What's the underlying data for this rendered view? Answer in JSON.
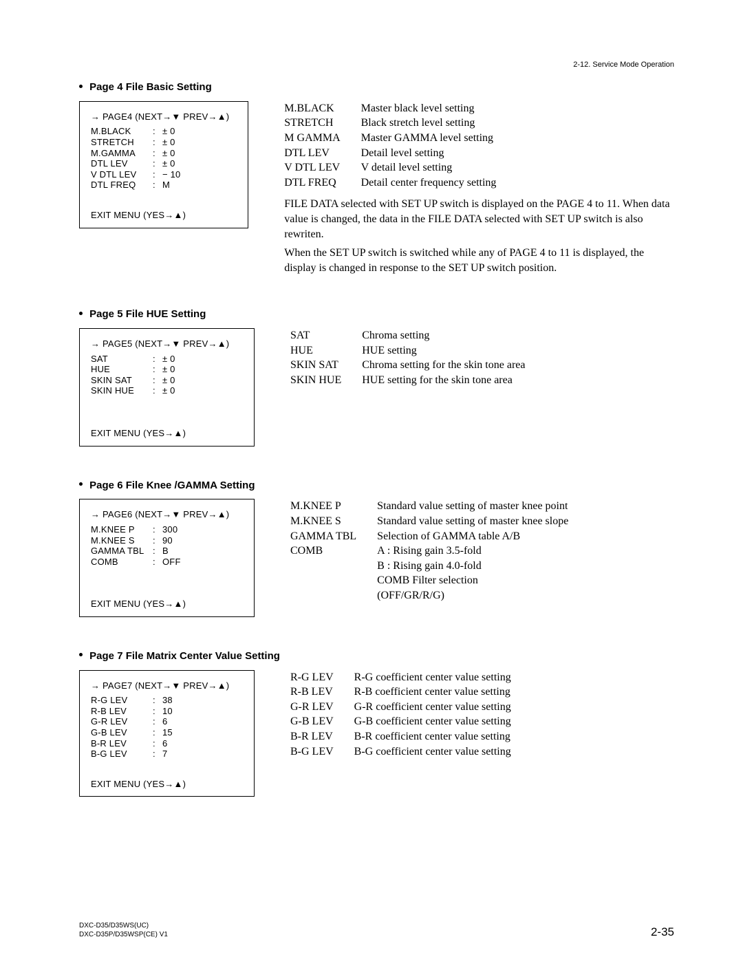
{
  "top_right": "2-12. Service Mode Operation",
  "sections": [
    {
      "title": "Page 4 File Basic Setting",
      "menu": {
        "header_prefix": "→ PAGE4  (NEXT→",
        "header_mid": "▼",
        "header_mid2": " PREV→",
        "header_suffix": "▲)",
        "rows": [
          {
            "lbl": "M.BLACK",
            "val": "± 0"
          },
          {
            "lbl": "STRETCH",
            "val": "± 0"
          },
          {
            "lbl": "M.GAMMA",
            "val": "± 0"
          },
          {
            "lbl": "DTL LEV",
            "val": "± 0"
          },
          {
            "lbl": "V DTL LEV",
            "val": "− 10"
          },
          {
            "lbl": "DTL FREQ",
            "val": "   M"
          }
        ],
        "exit": "EXIT MENU   (YES→▲)"
      },
      "desc_rows": [
        {
          "label": "M.BLACK",
          "text": "Master black level setting"
        },
        {
          "label": "STRETCH",
          "text": "Black stretch level setting"
        },
        {
          "label": "M GAMMA",
          "text": "Master GAMMA level setting"
        },
        {
          "label": "DTL LEV",
          "text": "Detail level setting"
        },
        {
          "label": "V DTL LEV",
          "text": "V detail level setting"
        },
        {
          "label": "DTL FREQ",
          "text": "Detail center frequency setting"
        }
      ],
      "para1": "FILE DATA selected with SET UP switch is displayed on the PAGE 4 to 11. When data value is changed, the data in the FILE DATA selected with SET UP switch is also rewriten.",
      "para2": "When the SET UP switch is switched while any of PAGE 4 to 11 is displayed, the display is changed in response to the SET UP switch position."
    },
    {
      "title": "Page 5 File HUE Setting",
      "menu": {
        "header_prefix": "→ PAGE5  (NEXT→",
        "header_mid": "▼",
        "header_mid2": " PREV→",
        "header_suffix": "▲)",
        "rows": [
          {
            "lbl": "SAT",
            "val": "± 0"
          },
          {
            "lbl": "HUE",
            "val": "± 0"
          },
          {
            "lbl": "SKIN SAT",
            "val": "± 0"
          },
          {
            "lbl": "SKIN HUE",
            "val": "± 0"
          }
        ],
        "exit": "EXIT MENU   (YES→▲)"
      },
      "desc_rows": [
        {
          "label": "SAT",
          "text": "Chroma  setting"
        },
        {
          "label": "HUE",
          "text": "HUE setting"
        },
        {
          "label": "SKIN SAT",
          "text": "Chroma  setting for the skin tone area"
        },
        {
          "label": "SKIN HUE",
          "text": "HUE setting for the skin tone area"
        }
      ]
    },
    {
      "title": "Page 6 File Knee /GAMMA Setting",
      "menu": {
        "header_prefix": "→ PAGE6  (NEXT→",
        "header_mid": "▼",
        "header_mid2": " PREV→",
        "header_suffix": "▲)",
        "rows": [
          {
            "lbl": "M.KNEE P",
            "val": "300"
          },
          {
            "lbl": "M.KNEE S",
            "val": "  90"
          },
          {
            "lbl": "GAMMA TBL",
            "val": "    B"
          },
          {
            "lbl": "COMB",
            "val": "OFF"
          }
        ],
        "exit": "EXIT MENU   (YES→▲)"
      },
      "desc_rows": [
        {
          "label": "M.KNEE P",
          "text": "Standard value setting of master knee point"
        },
        {
          "label": "M.KNEE S",
          "text": "Standard value setting of master knee slope"
        },
        {
          "label": "GAMMA TBL",
          "text": "Selection of GAMMA table A/B"
        },
        {
          "label": "COMB",
          "text": "A : Rising gain 3.5-fold"
        },
        {
          "label": "",
          "text": "B : Rising gain 4.0-fold"
        },
        {
          "label": "",
          "text": "COMB Filter selection"
        },
        {
          "label": "",
          "text": "(OFF/GR/R/G)"
        }
      ]
    },
    {
      "title": "Page 7 File Matrix Center Value Setting",
      "menu": {
        "header_prefix": "→ PAGE7  (NEXT→",
        "header_mid": "▼",
        "header_mid2": " PREV→",
        "header_suffix": "▲)",
        "rows": [
          {
            "lbl": "R-G LEV",
            "val": "  38"
          },
          {
            "lbl": "R-B LEV",
            "val": "  10"
          },
          {
            "lbl": "G-R LEV",
            "val": "    6"
          },
          {
            "lbl": "G-B LEV",
            "val": "  15"
          },
          {
            "lbl": "B-R LEV",
            "val": "    6"
          },
          {
            "lbl": "B-G LEV",
            "val": "    7"
          }
        ],
        "exit": "EXIT MENU   (YES→▲)"
      },
      "desc_rows": [
        {
          "label": "R-G LEV",
          "text": "R-G coefficient center value setting"
        },
        {
          "label": "R-B LEV",
          "text": "R-B coefficient center value setting"
        },
        {
          "label": "G-R LEV",
          "text": "G-R coefficient center value setting"
        },
        {
          "label": "G-B LEV",
          "text": "G-B coefficient center value setting"
        },
        {
          "label": "B-R LEV",
          "text": "B-R coefficient center value setting"
        },
        {
          "label": "B-G LEV",
          "text": "B-G coefficient center value setting"
        }
      ]
    }
  ],
  "footer": {
    "left1": "DXC-D35/D35WS(UC)",
    "left2": "DXC-D35P/D35WSP(CE) V1",
    "right": "2-35"
  }
}
